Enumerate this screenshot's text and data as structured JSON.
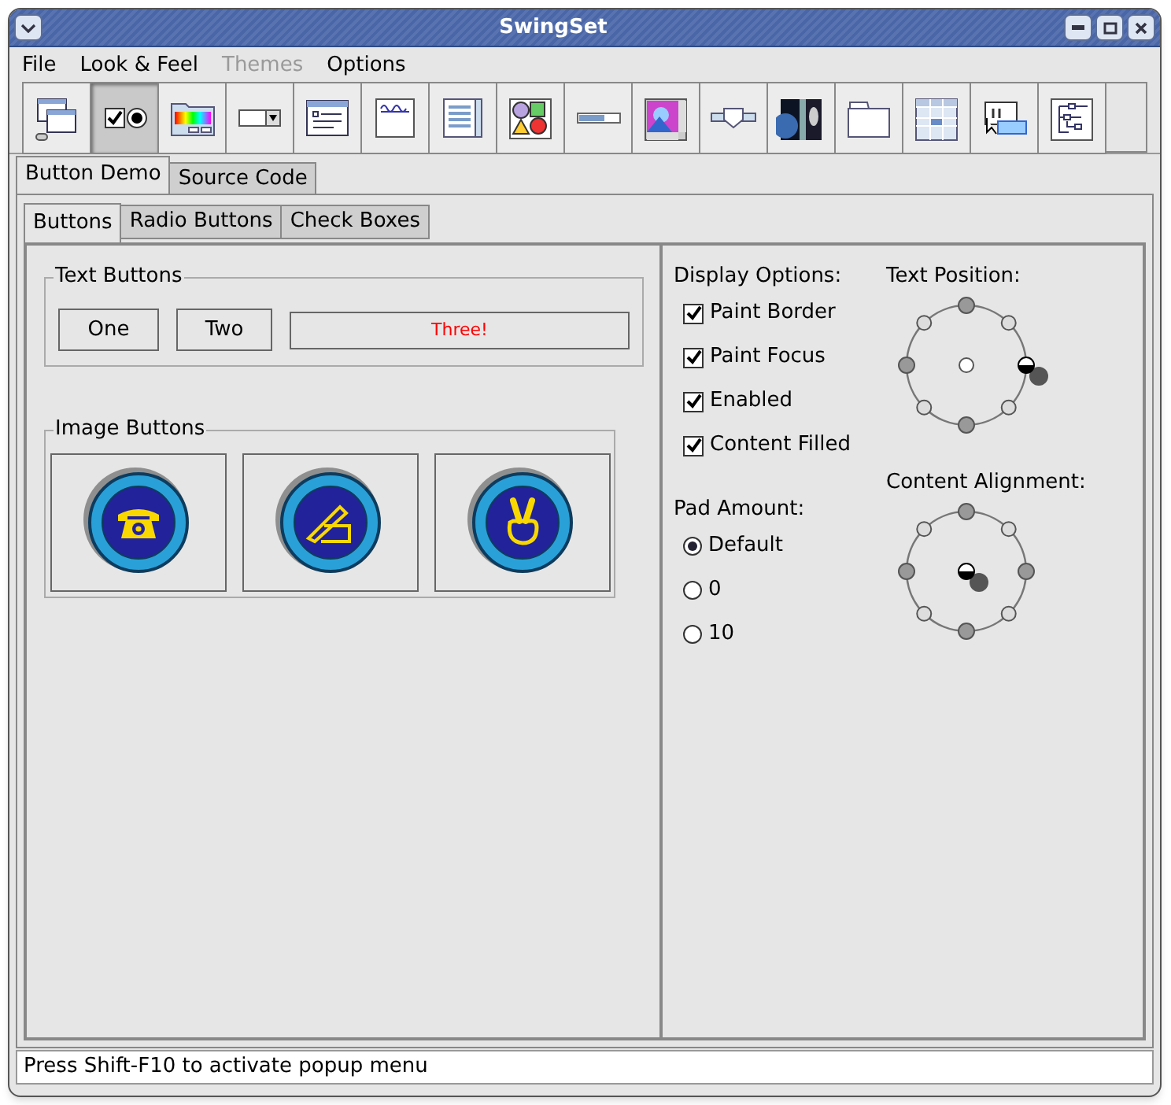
{
  "window": {
    "title": "SwingSet"
  },
  "menu": [
    {
      "label": "File",
      "disabled": false
    },
    {
      "label": "Look & Feel",
      "disabled": false
    },
    {
      "label": "Themes",
      "disabled": true
    },
    {
      "label": "Options",
      "disabled": false
    }
  ],
  "toolbar": [
    {
      "selected": false
    },
    {
      "selected": true
    },
    {
      "selected": false
    },
    {
      "selected": false
    },
    {
      "selected": false
    },
    {
      "selected": false
    },
    {
      "selected": false
    },
    {
      "selected": false
    },
    {
      "selected": false
    },
    {
      "selected": false
    },
    {
      "selected": false
    },
    {
      "selected": false
    },
    {
      "selected": false
    },
    {
      "selected": false
    },
    {
      "selected": false
    },
    {
      "selected": false
    }
  ],
  "demo_tabs": [
    {
      "label": "Button Demo",
      "selected": true
    },
    {
      "label": "Source Code",
      "selected": false
    }
  ],
  "tabs": [
    {
      "label": "Buttons",
      "selected": true
    },
    {
      "label": "Radio Buttons",
      "selected": false
    },
    {
      "label": "Check Boxes",
      "selected": false
    }
  ],
  "text_buttons": {
    "title": "Text Buttons",
    "buttons": [
      {
        "label": "One",
        "kind": "plain"
      },
      {
        "label": "Two",
        "kind": "plain"
      },
      {
        "label": "Three!",
        "kind": "wide"
      }
    ]
  },
  "image_buttons": {
    "title": "Image Buttons",
    "buttons": [
      {
        "kind": "phone"
      },
      {
        "kind": "pen"
      },
      {
        "kind": "peace"
      }
    ]
  },
  "display_options": {
    "title": "Display Options:",
    "items": [
      {
        "label": "Paint Border",
        "checked": true
      },
      {
        "label": "Paint Focus",
        "checked": true
      },
      {
        "label": "Enabled",
        "checked": true
      },
      {
        "label": "Content Filled",
        "checked": true
      }
    ]
  },
  "text_position": {
    "title": "Text Position:",
    "positions": [
      {
        "selected": false
      },
      {
        "selected": false
      },
      {
        "selected": true
      },
      {
        "selected": false
      },
      {
        "selected": false
      },
      {
        "selected": false
      },
      {
        "selected": false
      },
      {
        "selected": false
      },
      {
        "selected": false
      }
    ]
  },
  "pad_amount": {
    "title": "Pad Amount:",
    "items": [
      {
        "label": "Default",
        "selected": true
      },
      {
        "label": "0",
        "selected": false
      },
      {
        "label": "10",
        "selected": false
      }
    ]
  },
  "content_alignment": {
    "title": "Content Alignment:",
    "positions": [
      {
        "selected": false
      },
      {
        "selected": false
      },
      {
        "selected": false
      },
      {
        "selected": false
      },
      {
        "selected": false
      },
      {
        "selected": false
      },
      {
        "selected": false
      },
      {
        "selected": false
      },
      {
        "selected": true
      }
    ]
  },
  "status_bar": "Press Shift-F10 to activate popup menu"
}
